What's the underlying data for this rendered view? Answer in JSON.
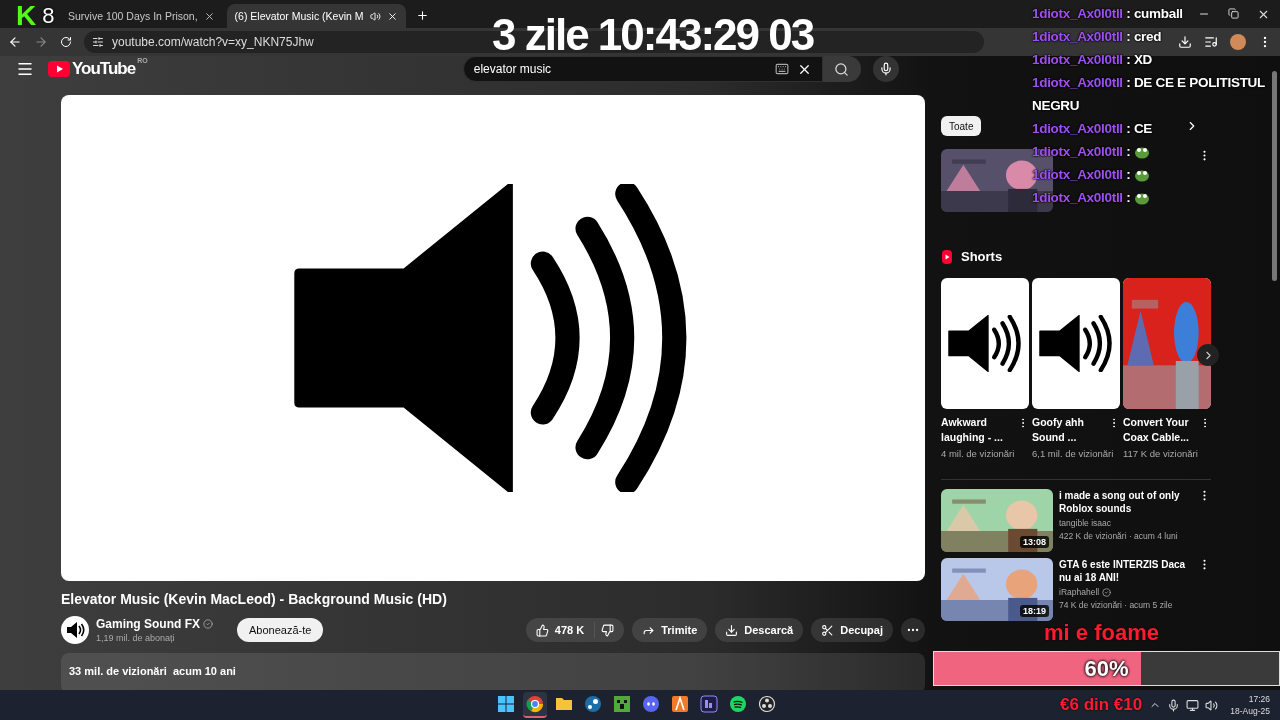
{
  "overlay": {
    "logo": "K",
    "counter": "8",
    "timer": "3 zile 10:43:29 03",
    "chat": [
      {
        "user": "1diotx_Ax0l0tll",
        "message": ": cumball"
      },
      {
        "user": "1diotx_Ax0l0tll",
        "message": ": cred"
      },
      {
        "user": "1diotx_Ax0l0tll",
        "message": ": XD"
      },
      {
        "user": "1diotx_Ax0l0tll",
        "message": ": DE CE E POLITISTUL NEGRU"
      },
      {
        "user": "1diotx_Ax0l0tll",
        "message": ": CE"
      },
      {
        "user": "1diotx_Ax0l0tll",
        "message": ":",
        "emote": true
      },
      {
        "user": "1diotx_Ax0l0tll",
        "message": ":",
        "emote": true
      },
      {
        "user": "1diotx_Ax0l0tll",
        "message": ":",
        "emote": true
      }
    ],
    "goal": {
      "title": "mi e foame",
      "level": 0.6,
      "reading": "60%",
      "amount": "€6 din €10"
    }
  },
  "browser": {
    "tabs": [
      {
        "title": "Survive 100 Days In Prison,",
        "selected": false,
        "audio": false
      },
      {
        "title": "(6) Elevator Music (Kevin M",
        "selected": true,
        "audio": true
      }
    ],
    "url": "youtube.com/watch?v=xy_NKN75Jhw"
  },
  "youtube": {
    "logo": "YouTube",
    "region": "RO",
    "search": {
      "value": "elevator music"
    },
    "video": {
      "title": "Elevator Music (Kevin MacLeod) - Background Music (HD)",
      "channel": "Gaming Sound FX",
      "verified": true,
      "subscribers": "1,19 mil. de abonați",
      "subscribe": "Abonează-te",
      "likes": "478 K",
      "actions": [
        "Trimite",
        "Descarcă",
        "Decupaj"
      ],
      "stats": "33 mil. de vizionări  acum 10 ani"
    },
    "chips": [
      {
        "label": "Toate",
        "selected": true
      }
    ],
    "shorts": {
      "title": "Shorts",
      "items": [
        {
          "kind": "speaker",
          "title": "Awkward laughing - ...",
          "views": "4 mil. de vizionări"
        },
        {
          "kind": "speaker",
          "title": "Goofy ahh Sound ...",
          "views": "6,1 mil. de vizionări"
        },
        {
          "kind": "picture",
          "title": "Convert Your Coax Cable...",
          "views": "117 K de vizionări"
        }
      ]
    },
    "related": [
      {
        "title": "i made a song out of only Roblox sounds",
        "channel": "tangible isaac",
        "verified": false,
        "meta": "422 K de vizionări · acum 4 luni",
        "duration": "13:08"
      },
      {
        "title": "GTA 6 este INTERZIS Daca nu ai 18 ANI!",
        "channel": "iRaphahell",
        "verified": true,
        "meta": "74 K de vizionări · acum 5 zile",
        "duration": "18:19"
      }
    ]
  },
  "taskbar": {
    "apps": [
      {
        "kind": "start",
        "selected": false
      },
      {
        "kind": "browser",
        "selected": true
      },
      {
        "kind": "folder",
        "selected": false
      },
      {
        "kind": "steam",
        "selected": false
      },
      {
        "kind": "block",
        "selected": false
      },
      {
        "kind": "chat",
        "selected": false
      },
      {
        "kind": "orange",
        "selected": false
      },
      {
        "kind": "pr",
        "selected": false
      },
      {
        "kind": "music",
        "selected": false
      },
      {
        "kind": "record",
        "selected": false
      }
    ],
    "time": "17:26",
    "date": "18-Aug-25"
  }
}
